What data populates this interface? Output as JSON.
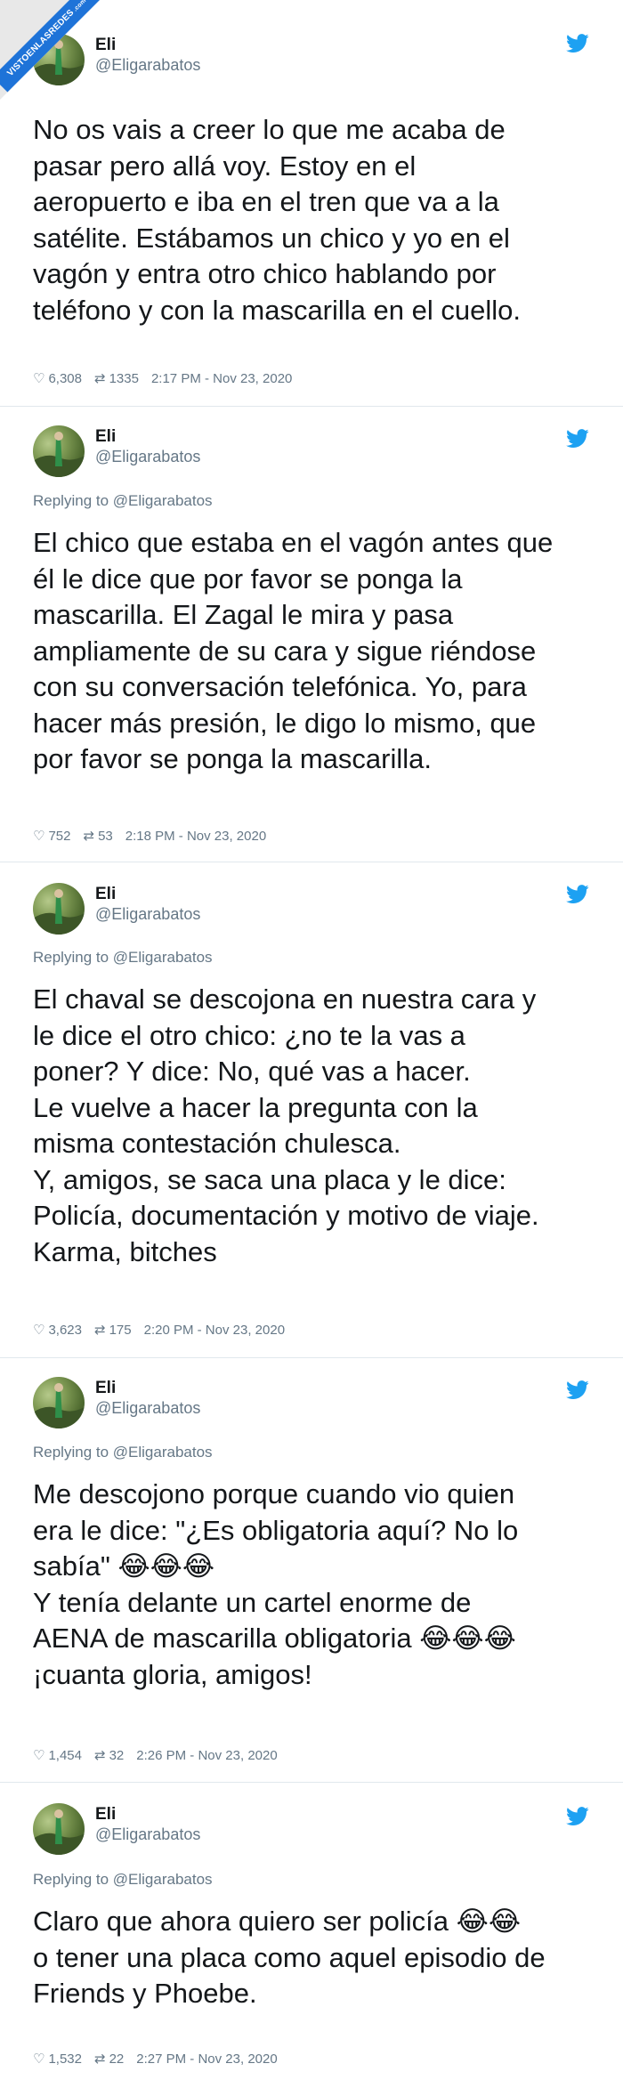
{
  "watermark": {
    "text": "VISTOENLASREDES",
    "sub": ".com"
  },
  "author": {
    "name": "Eli",
    "handle": "@Eligarabatos"
  },
  "icons": {
    "like": "heart-icon",
    "retweet": "retweet-icon",
    "brand": "twitter-bird-icon"
  },
  "colors": {
    "bird": "#1da1f2",
    "muted": "#657786",
    "text": "#14171a"
  },
  "tweets": [
    {
      "reply": "",
      "text": "No os vais a creer lo que me acaba de\npasar pero allá voy. Estoy en el\naeropuerto e iba en el tren que va a la\nsatélite. Estábamos un chico y yo en el\nvagón y entra otro chico hablando por\nteléfono y con la mascarilla en el cuello.",
      "likes": "6,308",
      "retweets": "1335",
      "time": "2:17 PM - Nov 23, 2020"
    },
    {
      "reply": "Replying to @Eligarabatos",
      "text": "El chico que estaba en el vagón antes que\nél le dice que por favor se ponga la\nmascarilla. El Zagal le mira y pasa\nampliamente de su cara y sigue riéndose\ncon su conversación telefónica. Yo, para\nhacer más presión, le digo lo mismo, que\npor favor se ponga la mascarilla.",
      "likes": "752",
      "retweets": "53",
      "time": "2:18 PM - Nov 23, 2020"
    },
    {
      "reply": "Replying to @Eligarabatos",
      "text": "El chaval se descojona en nuestra cara y\nle dice el otro chico: ¿no te la vas a\nponer? Y dice: No, qué vas a hacer.\nLe vuelve a hacer la pregunta con la\nmisma contestación chulesca.\nY, amigos, se saca una placa y le dice:\nPolicía, documentación y motivo de viaje.\nKarma, bitches",
      "likes": "3,623",
      "retweets": "175",
      "time": "2:20 PM - Nov 23, 2020"
    },
    {
      "reply": "Replying to @Eligarabatos",
      "text": "Me descojono porque cuando vio quien\nera le dice: \"¿Es obligatoria aquí? No lo\nsabía\" 😂😂😂\nY tenía delante un cartel enorme de\nAENA de mascarilla obligatoria 😂😂😂\n¡cuanta gloria, amigos!",
      "likes": "1,454",
      "retweets": "32",
      "time": "2:26 PM - Nov 23, 2020"
    },
    {
      "reply": "Replying to @Eligarabatos",
      "text": "Claro que ahora quiero ser policía 😂😂\no tener una placa como aquel episodio de\nFriends y Phoebe.",
      "likes": "1,532",
      "retweets": "22",
      "time": "2:27 PM - Nov 23, 2020"
    }
  ]
}
